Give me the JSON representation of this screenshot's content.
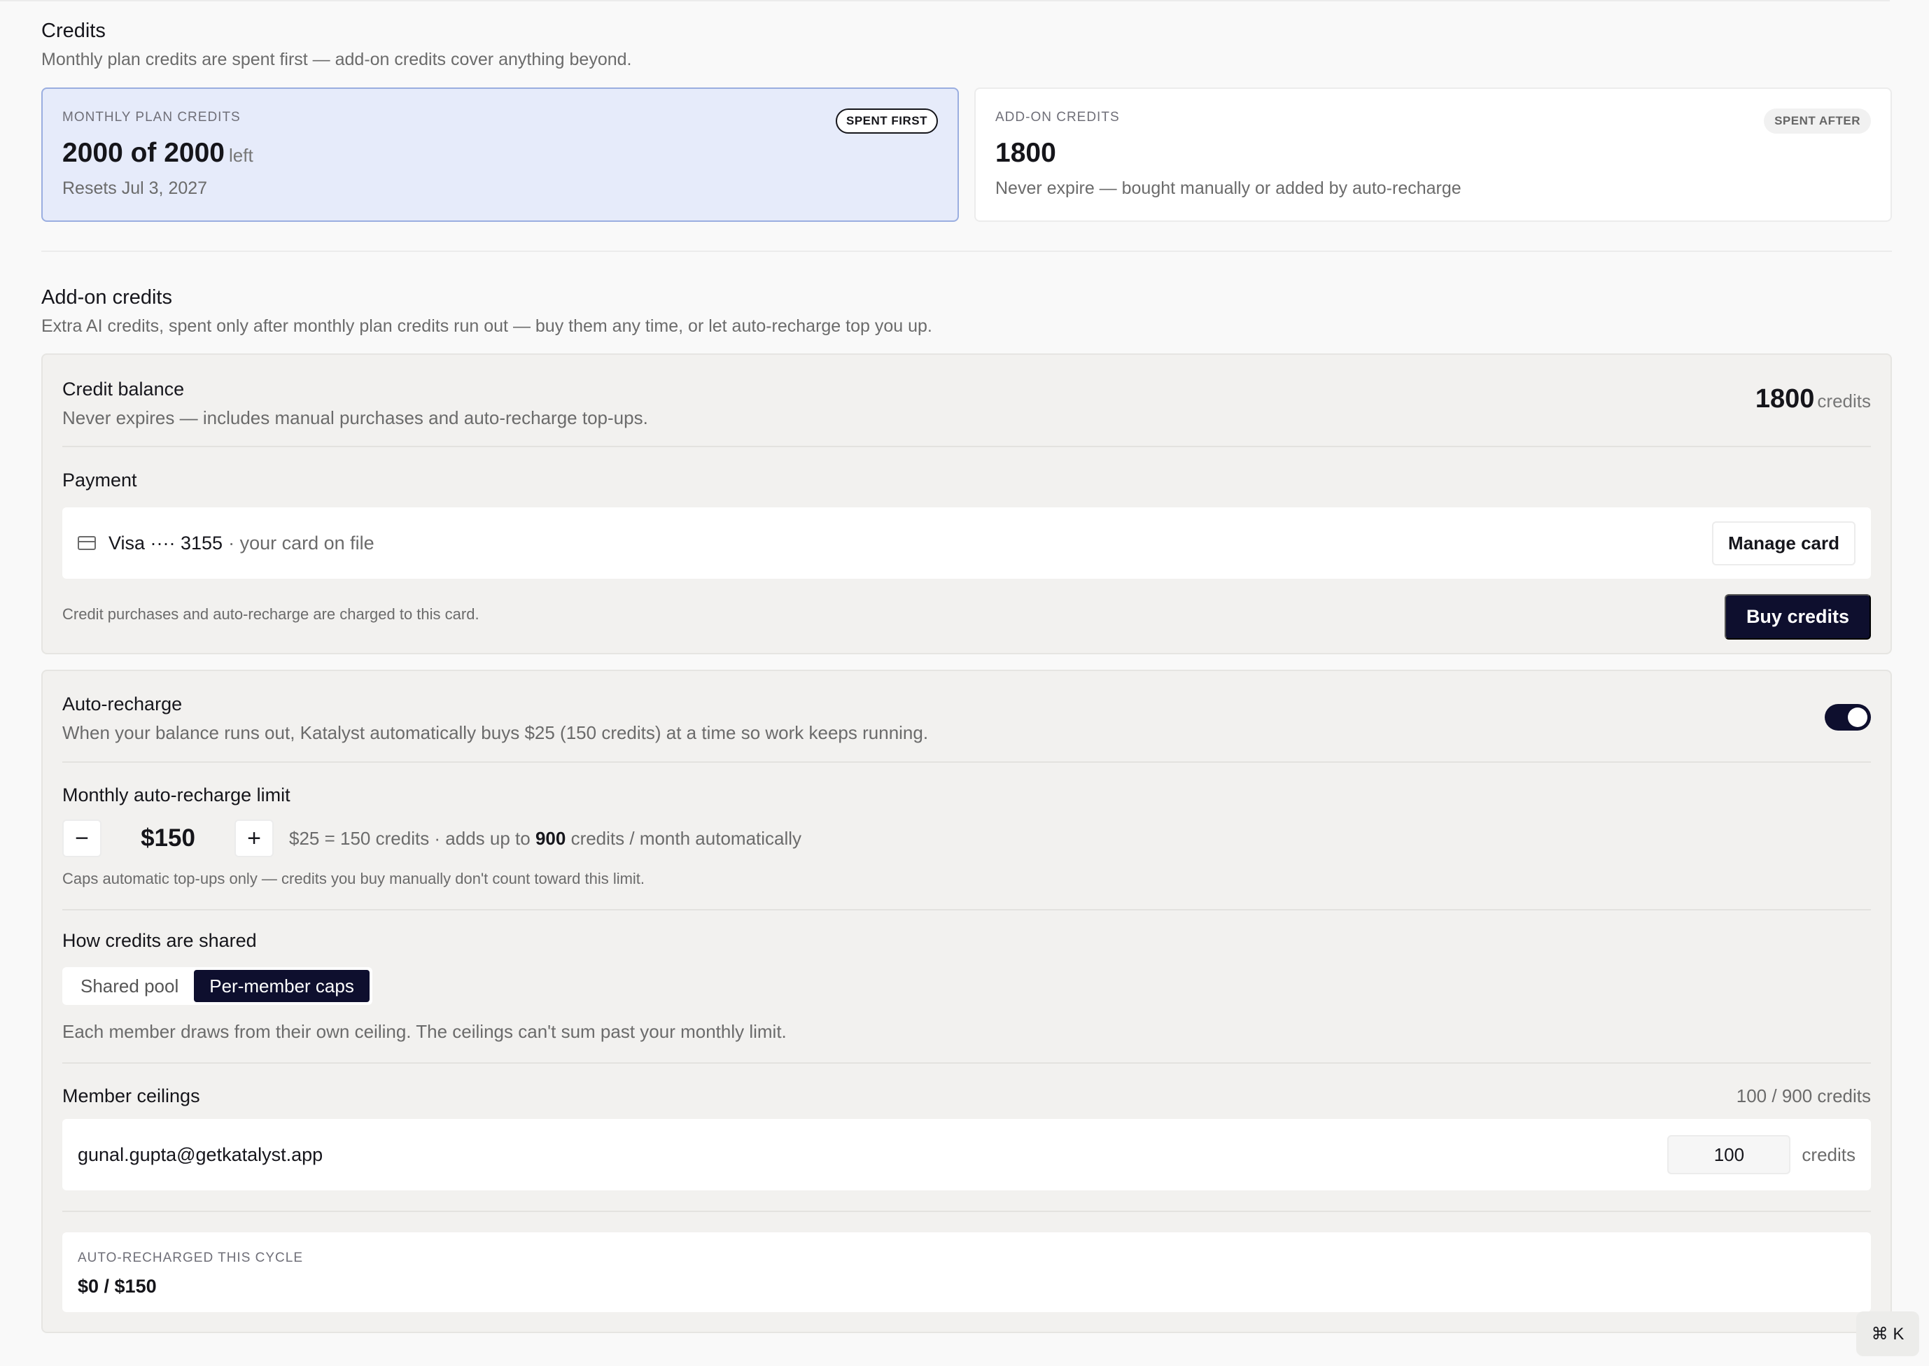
{
  "credits": {
    "title": "Credits",
    "subtitle": "Monthly plan credits are spent first — add-on credits cover anything beyond.",
    "monthly": {
      "eyebrow": "MONTHLY PLAN CREDITS",
      "badge": "SPENT FIRST",
      "amount": "2000 of 2000",
      "amount_unit": "left",
      "detail": "Resets Jul 3, 2027"
    },
    "addon": {
      "eyebrow": "ADD-ON CREDITS",
      "badge": "SPENT AFTER",
      "amount": "1800",
      "detail": "Never expire — bought manually or added by auto-recharge"
    }
  },
  "addon_section": {
    "title": "Add-on credits",
    "subtitle": "Extra AI credits, spent only after monthly plan credits run out — buy them any time, or let auto-recharge top you up."
  },
  "balance": {
    "title": "Credit balance",
    "subtitle": "Never expires — includes manual purchases and auto-recharge top-ups.",
    "amount": "1800",
    "unit": "credits"
  },
  "payment": {
    "label": "Payment",
    "card_brand": "Visa ···· 3155",
    "card_note": "· your card on file",
    "manage_label": "Manage card",
    "charge_note": "Credit purchases and auto-recharge are charged to this card.",
    "buy_label": "Buy credits"
  },
  "auto_recharge": {
    "title": "Auto-recharge",
    "subtitle": "When your balance runs out, Katalyst automatically buys $25 (150 credits) at a time so work keeps running.",
    "enabled": true,
    "limit_label": "Monthly auto-recharge limit",
    "minus": "−",
    "plus": "+",
    "limit_value": "$150",
    "rate_text": "$25 = 150 credits · adds up to ",
    "max_credits": "900",
    "rate_suffix": " credits / month automatically",
    "caps_note": "Caps automatic top-ups only — credits you buy manually don't count toward this limit."
  },
  "sharing": {
    "title": "How credits are shared",
    "options": [
      "Shared pool",
      "Per-member caps"
    ],
    "selected": "Per-member caps",
    "note": "Each member draws from their own ceiling. The ceilings can't sum past your monthly limit."
  },
  "members": {
    "title": "Member ceilings",
    "count": "100 / 900 credits",
    "rows": [
      {
        "email": "gunal.gupta@getkatalyst.app",
        "value": "100",
        "unit": "credits"
      }
    ]
  },
  "cycle": {
    "eyebrow": "AUTO-RECHARGED THIS CYCLE",
    "value": "$0 / $150"
  },
  "shortcut": "⌘ K",
  "colors": {
    "accent_dark": "#0e0f2e",
    "primary_card_bg": "#e6ebfa",
    "primary_card_border": "#9aaee0"
  }
}
